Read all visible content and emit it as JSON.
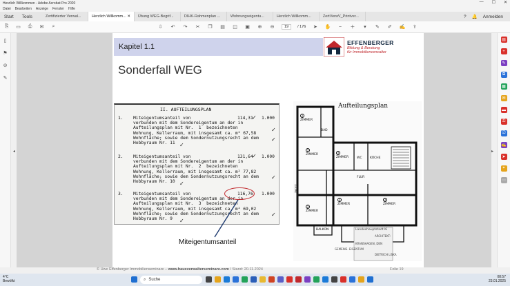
{
  "window": {
    "title": "Herzlich Willkommen - Adobe Acrobat Pro 2020",
    "controls": [
      "—",
      "☐",
      "✕"
    ]
  },
  "menu": [
    "Datei",
    "Bearbeiten",
    "Anzeige",
    "Fenster",
    "Hilfe"
  ],
  "tabs": {
    "start": "Start",
    "tools": "Tools",
    "documents": [
      {
        "label": "Zertifizierter Verwal...",
        "active": false
      },
      {
        "label": "Herzlich Willkomm...",
        "active": true
      },
      {
        "label": "Übung WEG-Begrif...",
        "active": false
      },
      {
        "label": "DIHK-Rahmenplan ...",
        "active": false
      },
      {
        "label": "Wohnungseigentu...",
        "active": false
      },
      {
        "label": "Herzlich Willkomm...",
        "active": false
      },
      {
        "label": "ZertVerwV_Printver...",
        "active": false
      }
    ],
    "signin": "Anmelden"
  },
  "toolbar": {
    "current_page": "19",
    "page_total": "/ 176"
  },
  "slide": {
    "chapter": "Kapitel 1.1",
    "title": "Sonderfall WEG",
    "logo_brand": "EFFENBERGER",
    "logo_tag1": "Bildung & Beratung",
    "logo_tag2": "für Immobilienverwalter",
    "caption": "Miteigentumsanteil",
    "footer_left": "© Uwe Effenberger Immobilienseminare",
    "footer_sep": "–",
    "footer_url": "www.hausverwalterseminare.com",
    "footer_stand": "/ Stand: 20.11.2024",
    "folio": "Folie 19"
  },
  "scan": {
    "heading": "II. AUFTEILUNGSPLAN",
    "items": [
      {
        "num": "1.",
        "share": "114,31",
        "total": "1.000",
        "lines": "Miteigentumsanteil von\nverbunden mit dem Sondereigentum an der in\nAufteilungsplan mit Nr.  1  bezeichneten\nWohnung, Kellerraum, mit insgesamt ca. m² 67,58\nWohnfläche; sowie dem Sondernutzungsrecht an dem\nHobbyraum Nr. 11"
      },
      {
        "num": "2.",
        "share": "131,64",
        "total": "1.000",
        "lines": "Miteigentumsanteil von\nverbunden mit dem Sondereigentum an der in\nAufteilungsplan mit Nr.  2  bezeichneten\nWohnung, Kellerraum, mit insgesamt ca. m² 77,82\nWohnfläche; sowie dem Sondernutzungsrecht an dem\nHobbyraum Nr. 10"
      },
      {
        "num": "3.",
        "share": "116,76",
        "total": "1.000",
        "lines": "Miteigentumsanteil von\nverbunden mit dem Sondereigentum an der in\nAufteilungsplan mit Nr.  3  bezeichneten\nWohnung, Kellerraum, mit insgesamt ca. m² 69,02\nWohnfläche; sowie dem Sondernutzungsrecht an dem\nHobbyraum Nr. 9"
      }
    ]
  },
  "plan": {
    "title": "Aufteilungsplan",
    "rooms": [
      "ZIMMER",
      "BAD",
      "ZIMMER",
      "ZIMMER",
      "WC",
      "KÜCHE",
      "FLUR",
      "ZIMMER",
      "ZIMMER",
      "ZIMMER",
      "BALKON"
    ],
    "stamp1": "Landeshauptstadt Ki",
    "stamp2": "ARCHITEKT:",
    "stamp3": "KRANSHAGEN, DEN",
    "stamp4": "GEMEINS. EIGENTUM",
    "stamp5": "DIETRICH LISKA",
    "dim": "13.94"
  },
  "taskbar": {
    "weather_temp": "4°C",
    "weather_text": "Bewölkt",
    "search": "Suche",
    "time": "08:57",
    "date": "23.01.2025"
  }
}
